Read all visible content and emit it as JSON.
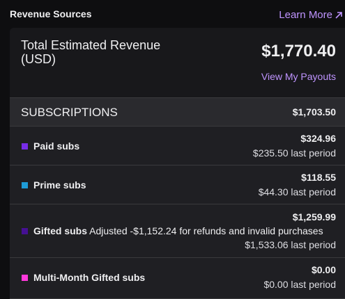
{
  "header": {
    "title": "Revenue Sources",
    "learn_more": "Learn More"
  },
  "total": {
    "label": "Total Estimated Revenue (USD)",
    "amount": "$1,770.40",
    "payouts_link": "View My Payouts"
  },
  "subscriptions": {
    "title": "SUBSCRIPTIONS",
    "amount": "$1,703.50",
    "items": [
      {
        "label": "Paid subs",
        "note": "",
        "amount": "$324.96",
        "previous": "$235.50 last period",
        "color": "#772ce8"
      },
      {
        "label": "Prime subs",
        "note": "",
        "amount": "$118.55",
        "previous": "$44.30 last period",
        "color": "#1e9bd6"
      },
      {
        "label": "Gifted subs",
        "note": "Adjusted -$1,152.24 for refunds and invalid purchases",
        "amount": "$1,259.99",
        "previous": "$1,533.06 last period",
        "color": "#451093"
      },
      {
        "label": "Multi-Month Gifted subs",
        "note": "",
        "amount": "$0.00",
        "previous": "$0.00 last period",
        "color": "#ff38db"
      }
    ]
  },
  "icons": {
    "external_link": "arrow-up-right-icon"
  },
  "colors": {
    "background": "#0e0e10",
    "card": "#1f1f23",
    "header_band": "#2a2a2e",
    "link": "#bf94ff",
    "text": "#efeff1"
  }
}
